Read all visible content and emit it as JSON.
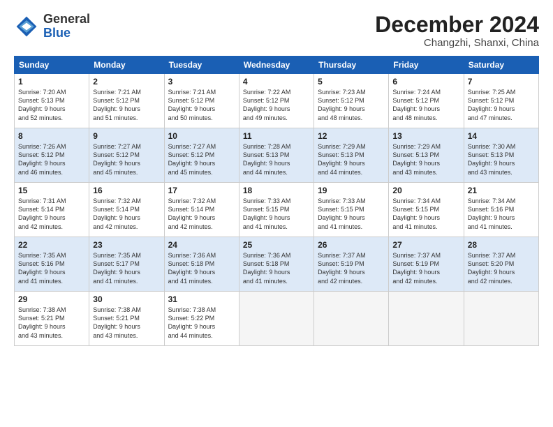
{
  "logo": {
    "general": "General",
    "blue": "Blue"
  },
  "header": {
    "month": "December 2024",
    "location": "Changzhi, Shanxi, China"
  },
  "weekdays": [
    "Sunday",
    "Monday",
    "Tuesday",
    "Wednesday",
    "Thursday",
    "Friday",
    "Saturday"
  ],
  "weeks": [
    [
      {
        "day": "1",
        "info": "Sunrise: 7:20 AM\nSunset: 5:13 PM\nDaylight: 9 hours\nand 52 minutes."
      },
      {
        "day": "2",
        "info": "Sunrise: 7:21 AM\nSunset: 5:12 PM\nDaylight: 9 hours\nand 51 minutes."
      },
      {
        "day": "3",
        "info": "Sunrise: 7:21 AM\nSunset: 5:12 PM\nDaylight: 9 hours\nand 50 minutes."
      },
      {
        "day": "4",
        "info": "Sunrise: 7:22 AM\nSunset: 5:12 PM\nDaylight: 9 hours\nand 49 minutes."
      },
      {
        "day": "5",
        "info": "Sunrise: 7:23 AM\nSunset: 5:12 PM\nDaylight: 9 hours\nand 48 minutes."
      },
      {
        "day": "6",
        "info": "Sunrise: 7:24 AM\nSunset: 5:12 PM\nDaylight: 9 hours\nand 48 minutes."
      },
      {
        "day": "7",
        "info": "Sunrise: 7:25 AM\nSunset: 5:12 PM\nDaylight: 9 hours\nand 47 minutes."
      }
    ],
    [
      {
        "day": "8",
        "info": "Sunrise: 7:26 AM\nSunset: 5:12 PM\nDaylight: 9 hours\nand 46 minutes."
      },
      {
        "day": "9",
        "info": "Sunrise: 7:27 AM\nSunset: 5:12 PM\nDaylight: 9 hours\nand 45 minutes."
      },
      {
        "day": "10",
        "info": "Sunrise: 7:27 AM\nSunset: 5:12 PM\nDaylight: 9 hours\nand 45 minutes."
      },
      {
        "day": "11",
        "info": "Sunrise: 7:28 AM\nSunset: 5:13 PM\nDaylight: 9 hours\nand 44 minutes."
      },
      {
        "day": "12",
        "info": "Sunrise: 7:29 AM\nSunset: 5:13 PM\nDaylight: 9 hours\nand 44 minutes."
      },
      {
        "day": "13",
        "info": "Sunrise: 7:29 AM\nSunset: 5:13 PM\nDaylight: 9 hours\nand 43 minutes."
      },
      {
        "day": "14",
        "info": "Sunrise: 7:30 AM\nSunset: 5:13 PM\nDaylight: 9 hours\nand 43 minutes."
      }
    ],
    [
      {
        "day": "15",
        "info": "Sunrise: 7:31 AM\nSunset: 5:14 PM\nDaylight: 9 hours\nand 42 minutes."
      },
      {
        "day": "16",
        "info": "Sunrise: 7:32 AM\nSunset: 5:14 PM\nDaylight: 9 hours\nand 42 minutes."
      },
      {
        "day": "17",
        "info": "Sunrise: 7:32 AM\nSunset: 5:14 PM\nDaylight: 9 hours\nand 42 minutes."
      },
      {
        "day": "18",
        "info": "Sunrise: 7:33 AM\nSunset: 5:15 PM\nDaylight: 9 hours\nand 41 minutes."
      },
      {
        "day": "19",
        "info": "Sunrise: 7:33 AM\nSunset: 5:15 PM\nDaylight: 9 hours\nand 41 minutes."
      },
      {
        "day": "20",
        "info": "Sunrise: 7:34 AM\nSunset: 5:15 PM\nDaylight: 9 hours\nand 41 minutes."
      },
      {
        "day": "21",
        "info": "Sunrise: 7:34 AM\nSunset: 5:16 PM\nDaylight: 9 hours\nand 41 minutes."
      }
    ],
    [
      {
        "day": "22",
        "info": "Sunrise: 7:35 AM\nSunset: 5:16 PM\nDaylight: 9 hours\nand 41 minutes."
      },
      {
        "day": "23",
        "info": "Sunrise: 7:35 AM\nSunset: 5:17 PM\nDaylight: 9 hours\nand 41 minutes."
      },
      {
        "day": "24",
        "info": "Sunrise: 7:36 AM\nSunset: 5:18 PM\nDaylight: 9 hours\nand 41 minutes."
      },
      {
        "day": "25",
        "info": "Sunrise: 7:36 AM\nSunset: 5:18 PM\nDaylight: 9 hours\nand 41 minutes."
      },
      {
        "day": "26",
        "info": "Sunrise: 7:37 AM\nSunset: 5:19 PM\nDaylight: 9 hours\nand 42 minutes."
      },
      {
        "day": "27",
        "info": "Sunrise: 7:37 AM\nSunset: 5:19 PM\nDaylight: 9 hours\nand 42 minutes."
      },
      {
        "day": "28",
        "info": "Sunrise: 7:37 AM\nSunset: 5:20 PM\nDaylight: 9 hours\nand 42 minutes."
      }
    ],
    [
      {
        "day": "29",
        "info": "Sunrise: 7:38 AM\nSunset: 5:21 PM\nDaylight: 9 hours\nand 43 minutes."
      },
      {
        "day": "30",
        "info": "Sunrise: 7:38 AM\nSunset: 5:21 PM\nDaylight: 9 hours\nand 43 minutes."
      },
      {
        "day": "31",
        "info": "Sunrise: 7:38 AM\nSunset: 5:22 PM\nDaylight: 9 hours\nand 44 minutes."
      },
      {
        "day": "",
        "info": ""
      },
      {
        "day": "",
        "info": ""
      },
      {
        "day": "",
        "info": ""
      },
      {
        "day": "",
        "info": ""
      }
    ]
  ]
}
